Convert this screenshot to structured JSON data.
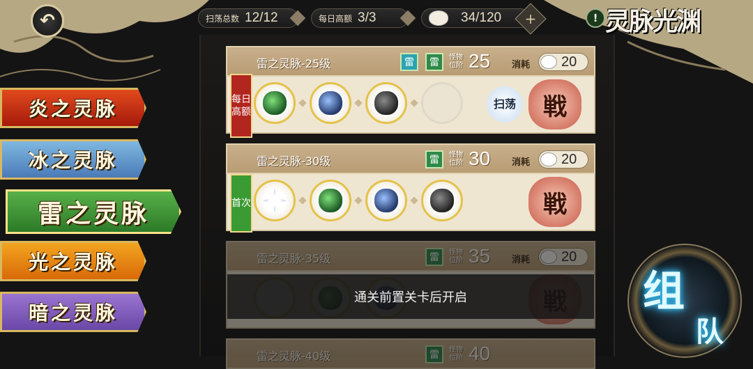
{
  "topbar": {
    "sweep_total_label": "扫荡总数",
    "sweep_total_value": "12/12",
    "daily_limit_label": "每日高额",
    "daily_limit_value": "3/3",
    "stamina_value": "34/120",
    "plus_symbol": "+",
    "info_symbol": "!",
    "logo_text": "灵脉光渊"
  },
  "tabs": [
    {
      "label": "炎之灵脉",
      "color": "#c8321a"
    },
    {
      "label": "冰之灵脉",
      "color": "#6a9ed0"
    },
    {
      "label": "雷之灵脉",
      "color": "#3a9a34",
      "selected": true
    },
    {
      "label": "光之灵脉",
      "color": "#e88a14"
    },
    {
      "label": "暗之灵脉",
      "color": "#8a60c0"
    }
  ],
  "common": {
    "rank_label": "怪物位阶",
    "cost_label": "消耗",
    "element_icon": "雷",
    "sweep_label": "扫荡",
    "battle_label": "戦"
  },
  "stages": [
    {
      "title": "雷之灵脉-25级",
      "rank": "25",
      "cost": "20",
      "ribbon": "每日高额",
      "rewards": [
        "green-crystal",
        "blue-crystal",
        "dark-crystal",
        "empty"
      ]
    },
    {
      "title": "雷之灵脉-30级",
      "rank": "30",
      "cost": "20",
      "ribbon": "首次",
      "rewards": [
        "star-crystal",
        "green-crystal",
        "blue-crystal",
        "dark-crystal"
      ]
    },
    {
      "title": "雷之灵脉-35级",
      "rank": "35",
      "cost": "20",
      "locked_text": "通关前置关卡后开启"
    },
    {
      "title": "雷之灵脉-40级",
      "rank": "40"
    }
  ],
  "team": {
    "line1": "组",
    "line2": "队"
  }
}
